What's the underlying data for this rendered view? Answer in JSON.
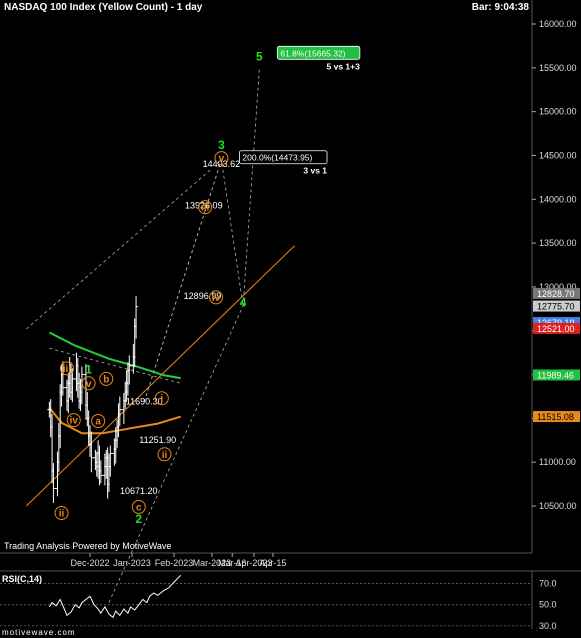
{
  "header": {
    "title": "NASDAQ 100 Index (Yellow Count) - 1 day",
    "bar_time": "Bar: 9:04:38"
  },
  "footer": {
    "watermark": "Trading Analysis Powered by MotiveWave",
    "site": "motivewave.com"
  },
  "colors": {
    "background": "#000000",
    "price_bars": "#ffffff",
    "wave_orange": "#e8881a",
    "wave_green": "#20e020",
    "ma_fast": "#e8881a",
    "ma_slow": "#20d040",
    "channel": "#b0b0b0",
    "price_tag_red": "#e02020",
    "price_tag_green": "#20c040",
    "price_tag_orange": "#e8881a",
    "price_tag_blue": "#4080e0"
  },
  "chart_data": [
    {
      "type": "candlestick",
      "title": "NASDAQ 100 Index (Yellow Count) - 1 day",
      "y_axis": {
        "ticks": [
          10500,
          11000,
          11500,
          12000,
          12500,
          13000,
          13500,
          14000,
          14500,
          15000,
          15500,
          16000
        ],
        "ylim": [
          10100,
          16300
        ],
        "price_tags": [
          {
            "value": 12828.7,
            "label": "12828.70",
            "color": "gray"
          },
          {
            "value": 12775.7,
            "label": "12775.70",
            "color": "white"
          },
          {
            "value": 12679.19,
            "label": "12679.19",
            "color": "blue"
          },
          {
            "value": 12521.0,
            "label": "12521.00",
            "color": "red"
          },
          {
            "value": 11989.46,
            "label": "11989.46",
            "color": "green"
          },
          {
            "value": 11515.08,
            "label": "11515.08",
            "color": "orange"
          }
        ]
      },
      "x_axis": {
        "ticks": [
          "Dec-2022",
          "Jan-2023",
          "Feb-2023",
          "Mar-2023",
          "Mar-16",
          "Apr-2023",
          "Apr-15"
        ]
      },
      "price_labels": [
        {
          "text": "14403.62",
          "x": "2023-03-08",
          "y": 14403.62
        },
        {
          "text": "13926.09",
          "x": "2023-02-23",
          "y": 13926.09
        },
        {
          "text": "12896.99",
          "x": "2023-02-22",
          "y": 12896.99
        },
        {
          "text": "11690.30",
          "x": "2023-01-10",
          "y": 11690.3
        },
        {
          "text": "11251.90",
          "x": "2023-01-20",
          "y": 11251.9
        },
        {
          "text": "10671.20",
          "x": "2023-01-06",
          "y": 10671.2
        }
      ],
      "fib_boxes": [
        {
          "text": "200.0%(14473.95)",
          "sub": "3 vs 1",
          "style": "white"
        },
        {
          "text": "61.8%(15665.32)",
          "sub": "5 vs 1+3",
          "style": "green"
        }
      ],
      "wave_labels": [
        {
          "text": "ii",
          "color": "orange",
          "x": "2022-11-10",
          "y": 10420
        },
        {
          "text": "iii",
          "color": "orange",
          "x": "2022-11-14",
          "y": 12070
        },
        {
          "text": "iv",
          "color": "orange",
          "x": "2022-11-19",
          "y": 11480
        },
        {
          "text": "1",
          "color": "green",
          "x": "2022-11-30",
          "y": 12060
        },
        {
          "text": "v",
          "color": "orange",
          "x": "2022-11-30",
          "y": 11900
        },
        {
          "text": "a",
          "color": "orange",
          "x": "2022-12-07",
          "y": 11470
        },
        {
          "text": "b",
          "color": "orange",
          "x": "2022-12-13",
          "y": 11950
        },
        {
          "text": "c",
          "color": "orange",
          "x": "2023-01-06",
          "y": 10490
        },
        {
          "text": "2",
          "color": "green",
          "x": "2023-01-06",
          "y": 10350
        },
        {
          "text": "i",
          "color": "orange",
          "x": "2023-01-23",
          "y": 11730
        },
        {
          "text": "ii",
          "color": "orange",
          "x": "2023-01-25",
          "y": 11090
        },
        {
          "text": "iii",
          "color": "orange",
          "x": "2023-02-24",
          "y": 13910
        },
        {
          "text": "3",
          "color": "green",
          "x": "2023-03-08",
          "y": 14620
        },
        {
          "text": "v",
          "color": "orange",
          "x": "2023-03-08",
          "y": 14470
        },
        {
          "text": "iv",
          "color": "orange",
          "x": "2023-03-04",
          "y": 12880
        },
        {
          "text": "4",
          "color": "green",
          "x": "2023-03-24",
          "y": 12820
        },
        {
          "text": "5",
          "color": "green",
          "x": "2023-04-05",
          "y": 15630
        }
      ],
      "wave_target_path": [
        {
          "x": "2023-01-10",
          "y": 11690
        },
        {
          "x": "2023-03-08",
          "y": 14450
        },
        {
          "x": "2023-03-24",
          "y": 12780
        },
        {
          "x": "2023-04-05",
          "y": 15500
        }
      ],
      "series": [
        {
          "name": "price",
          "note": "daily OHLC bars, Nov-2022 through early Feb-2023"
        },
        {
          "name": "moving average (orange)"
        },
        {
          "name": "moving average (green)"
        }
      ]
    },
    {
      "type": "line",
      "title": "RSI(C,14)",
      "ylim": [
        27,
        82
      ],
      "y_ticks": [
        30.0,
        50.0,
        70.0
      ],
      "reference_lines": [
        70,
        50,
        30
      ],
      "values": [
        48,
        52,
        49,
        55,
        46,
        40,
        43,
        50,
        47,
        52,
        55,
        58,
        50,
        46,
        42,
        48,
        41,
        38,
        44,
        40,
        46,
        42,
        48,
        45,
        50,
        55,
        52,
        58,
        61,
        59,
        62,
        64,
        66,
        70,
        74,
        78
      ]
    }
  ]
}
